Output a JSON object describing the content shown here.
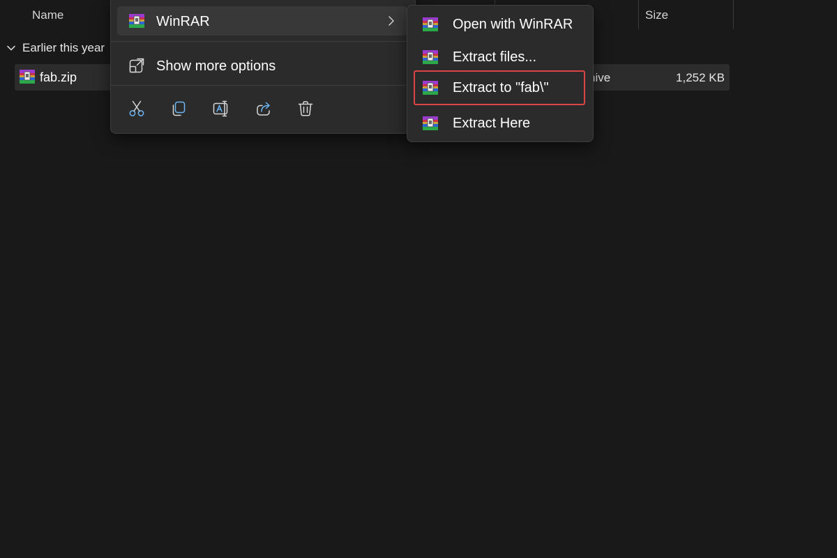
{
  "columns": {
    "name": "Name",
    "size": "Size"
  },
  "group": {
    "label": "Earlier this year"
  },
  "file": {
    "name": "fab.zip",
    "type_partial": "nive",
    "size": "1,252 KB"
  },
  "context_menu": {
    "winrar_label": "WinRAR",
    "show_more_label": "Show more options",
    "actions": [
      "cut-icon",
      "copy-icon",
      "rename-icon",
      "share-icon",
      "delete-icon"
    ]
  },
  "submenu": {
    "items": [
      {
        "label": "Open with WinRAR"
      },
      {
        "label": "Extract files..."
      },
      {
        "label": "Extract to \"fab\\\""
      },
      {
        "label": "Extract Here"
      }
    ]
  },
  "colors": {
    "highlight": "#e04545",
    "menu_bg": "#2b2b2b",
    "page_bg": "#191919",
    "icon_blue": "#6cb6f5"
  }
}
